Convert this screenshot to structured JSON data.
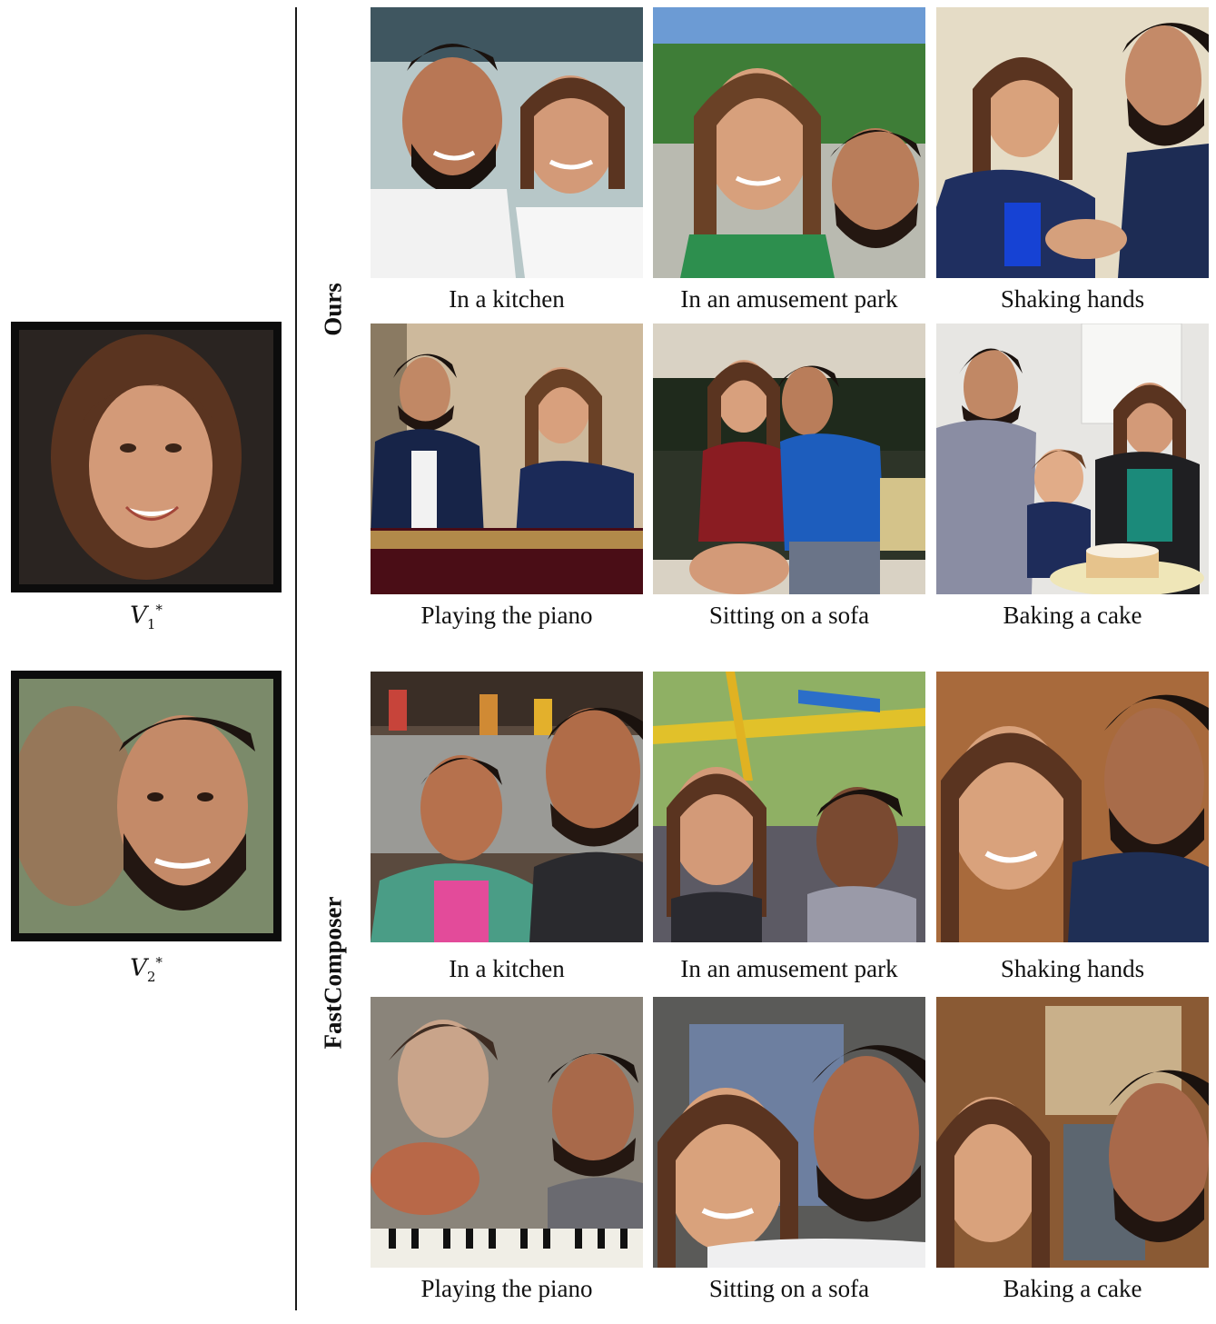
{
  "references": [
    {
      "subject": "V",
      "index": "1",
      "marker": "*"
    },
    {
      "subject": "V",
      "index": "2",
      "marker": "*"
    }
  ],
  "methods": [
    "Ours",
    "FastComposer"
  ],
  "grids": {
    "ours": {
      "row1": [
        "In a kitchen",
        "In an amusement park",
        "Shaking hands"
      ],
      "row2": [
        "Playing the piano",
        "Sitting on a sofa",
        "Baking a cake"
      ]
    },
    "fastcomposer": {
      "row1": [
        "In a kitchen",
        "In an amusement park",
        "Shaking hands"
      ],
      "row2": [
        "Playing the piano",
        "Sitting on a sofa",
        "Baking a cake"
      ]
    }
  },
  "colors": {
    "skin": "#c98b66",
    "hair_woman": "#5a3420",
    "hair_man": "#1d1410",
    "border": "#0c0c0c",
    "divider": "#1a1a1a"
  }
}
